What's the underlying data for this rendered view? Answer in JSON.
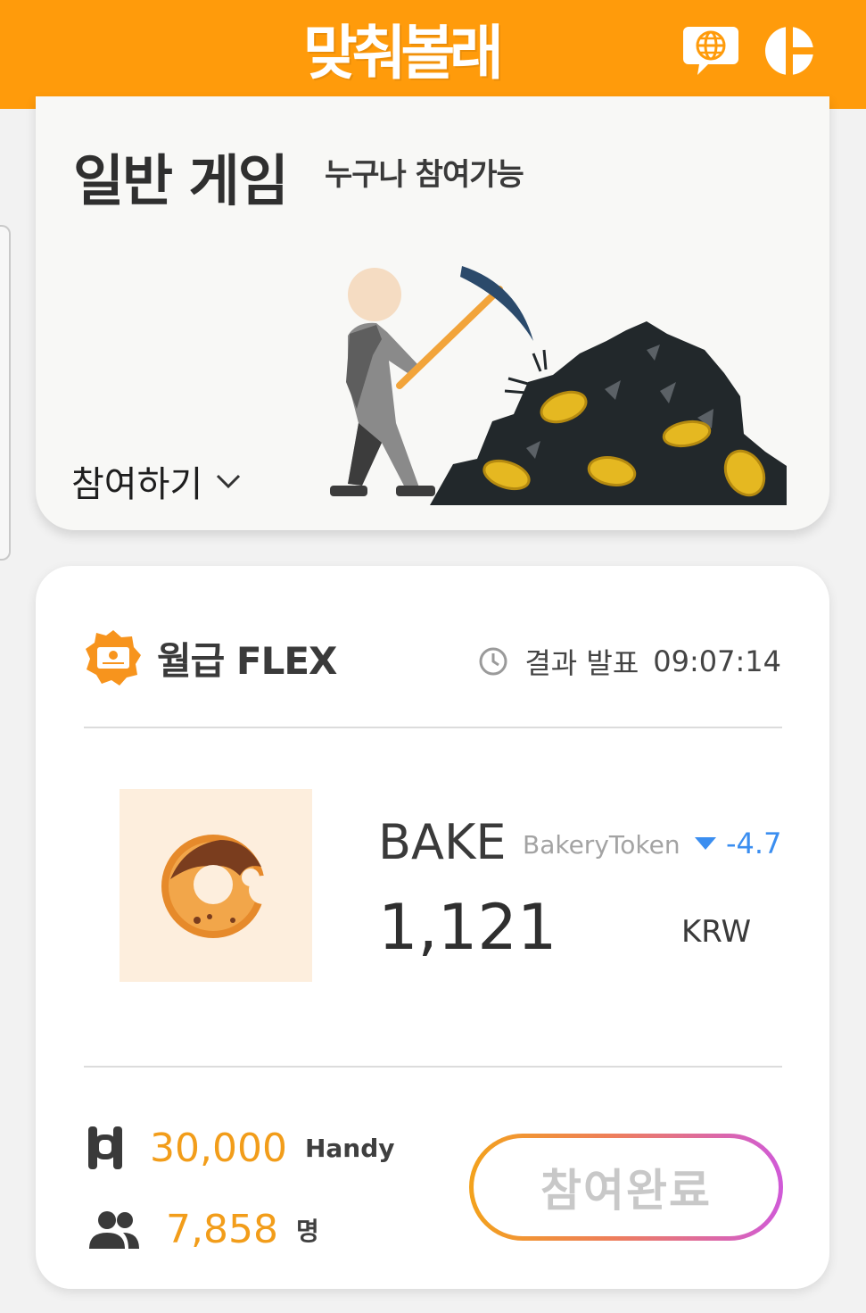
{
  "header": {
    "logo_text": "맞춰볼래",
    "colors": {
      "header_bg": "#ff9b0b",
      "logo_bar": "#2a1a6e"
    },
    "icons": [
      "globe-chat-icon",
      "pie-chart-icon"
    ]
  },
  "game_card": {
    "title": "일반 게임",
    "subtitle": "누구나 참여가능",
    "join_label": "참여하기",
    "illustration": "mining-illustration"
  },
  "flex_card": {
    "title": "월급 FLEX",
    "result_label": "결과 발표",
    "result_time": "09:07:14",
    "coin": {
      "symbol": "BAKE",
      "name": "BakeryToken",
      "change": "-4.72",
      "price": "1,121",
      "currency": "KRW"
    },
    "reward": {
      "amount": "30,000",
      "unit": "Handy"
    },
    "participants": {
      "count": "7,858",
      "unit": "명"
    },
    "status_button": "참여완료",
    "colors": {
      "number_accent": "#f29d1a",
      "change_down": "#3b8ef0"
    }
  }
}
